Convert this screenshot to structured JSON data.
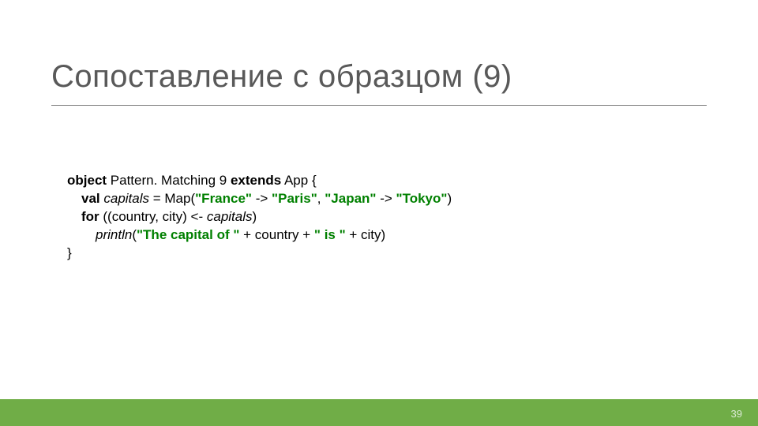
{
  "slide": {
    "title": "Сопоставление с образцом (9)",
    "page_number": "39"
  },
  "code": {
    "l1": {
      "kw": "object",
      "rest": " Pattern. Matching 9 ",
      "kw2": "extends",
      "rest2": " App {"
    },
    "l2": {
      "kw": "val",
      "it": " capitals",
      "rest": " = Map(",
      "s1": "\"France\"",
      "a1": " -> ",
      "s2": "\"Paris\"",
      "c": ", ",
      "s3": "\"Japan\"",
      "a2": " -> ",
      "s4": "\"Tokyo\"",
      "close": ")"
    },
    "l3": {
      "kw": "for",
      "p1": " ((country, city) <- ",
      "it": "capitals",
      "p2": ")"
    },
    "l4": {
      "it": "println",
      "p1": "(",
      "s1": "\"The capital of \"",
      "p2": " + country + ",
      "s2": "\" is \"",
      "p3": " + city)"
    },
    "l5": "}"
  }
}
